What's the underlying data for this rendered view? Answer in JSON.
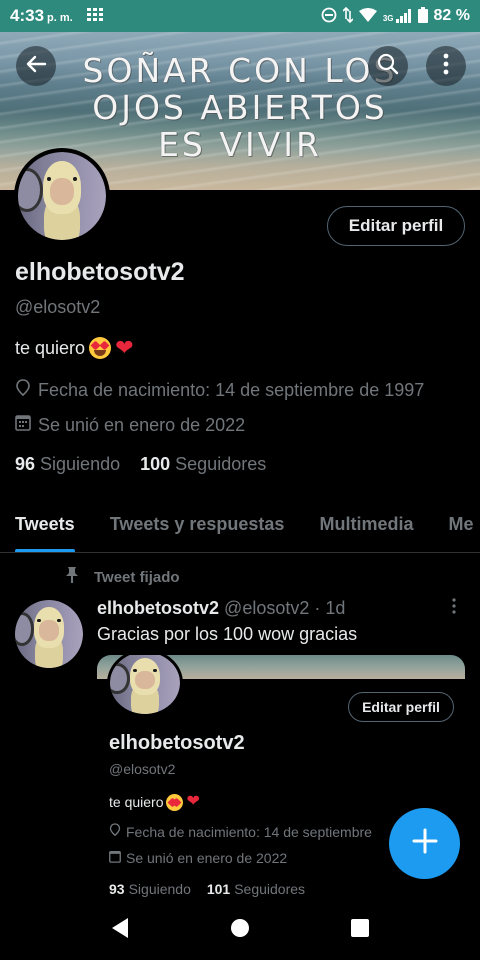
{
  "status_bar": {
    "time": "4:33",
    "ampm": "p. m.",
    "network": "3G",
    "battery": "82 %"
  },
  "banner": {
    "quote_lines": [
      "SOÑAR CON LOS",
      "OJOS ABIERTOS",
      "ES VIVIR"
    ]
  },
  "profile": {
    "edit_button": "Editar perfil",
    "display_name": "elhobetosotv2",
    "handle": "@elosotv2",
    "bio": "te quiero",
    "birth_date": "Fecha de nacimiento: 14 de septiembre de 1997",
    "joined": "Se unió en enero de 2022",
    "following_count": "96",
    "following_label": "Siguiendo",
    "followers_count": "100",
    "followers_label": "Seguidores"
  },
  "tabs": [
    {
      "label": "Tweets",
      "active": true
    },
    {
      "label": "Tweets y respuestas",
      "active": false
    },
    {
      "label": "Multimedia",
      "active": false
    },
    {
      "label": "Me",
      "active": false
    }
  ],
  "pinned_tweet": {
    "pinned_label": "Tweet fijado",
    "author_name": "elhobetosotv2",
    "author_handle": "@elosotv2",
    "age": "· 1d",
    "text": "Gracias por los 100 wow gracias",
    "embedded_screenshot": {
      "edit_button": "Editar perfil",
      "display_name": "elhobetosotv2",
      "handle": "@elosotv2",
      "bio": "te quiero",
      "birth_date": "Fecha de nacimiento: 14 de septiembre",
      "joined": "Se unió en enero de 2022",
      "following_count": "93",
      "following_label": "Siguiendo",
      "followers_count": "101",
      "followers_label": "Seguidores"
    }
  },
  "colors": {
    "accent": "#1d9bf0",
    "status_bar": "#2f8a7e",
    "muted_text": "#71767b"
  },
  "icons": [
    "back-arrow-icon",
    "search-icon",
    "more-vertical-icon",
    "location-icon",
    "calendar-icon",
    "pin-icon",
    "compose-plus-icon",
    "nav-back-icon",
    "nav-home-icon",
    "nav-recents-icon"
  ]
}
